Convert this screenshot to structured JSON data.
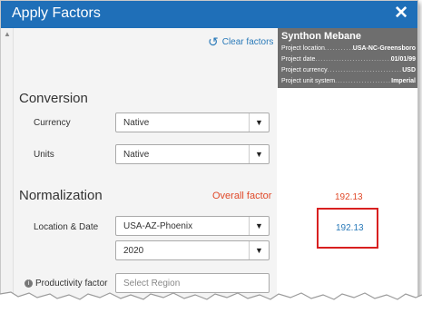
{
  "dialog": {
    "title": "Apply Factors",
    "close_icon": "close-icon"
  },
  "toolbar": {
    "clear_factors_label": "Clear factors",
    "clear_icon": "undo-icon"
  },
  "conversion": {
    "title": "Conversion",
    "currency": {
      "label": "Currency",
      "value": "Native"
    },
    "units": {
      "label": "Units",
      "value": "Native"
    }
  },
  "normalization": {
    "title": "Normalization",
    "overall_factor_label": "Overall factor",
    "location_date": {
      "label": "Location & Date",
      "location_value": "USA-AZ-Phoenix",
      "year_value": "2020"
    },
    "productivity": {
      "label": "Productivity factor",
      "placeholder": "Select Region",
      "icon": "info-icon"
    }
  },
  "project_card": {
    "name": "Synthon Mebane",
    "rows": [
      {
        "key": "Project location",
        "value": "USA-NC-Greensboro"
      },
      {
        "key": "Project date",
        "value": "01/01/99"
      },
      {
        "key": "Project currency",
        "value": "USD"
      },
      {
        "key": "Project unit system",
        "value": "Imperial"
      }
    ]
  },
  "factors": {
    "overall_value": "192.13",
    "location_value": "192.13"
  },
  "colors": {
    "titlebar": "#1f6fb8",
    "accent_link": "#2a7ab9",
    "overall_red": "#e04a2a",
    "highlight_box": "#d82020",
    "card_bg": "#6e6e6e"
  }
}
